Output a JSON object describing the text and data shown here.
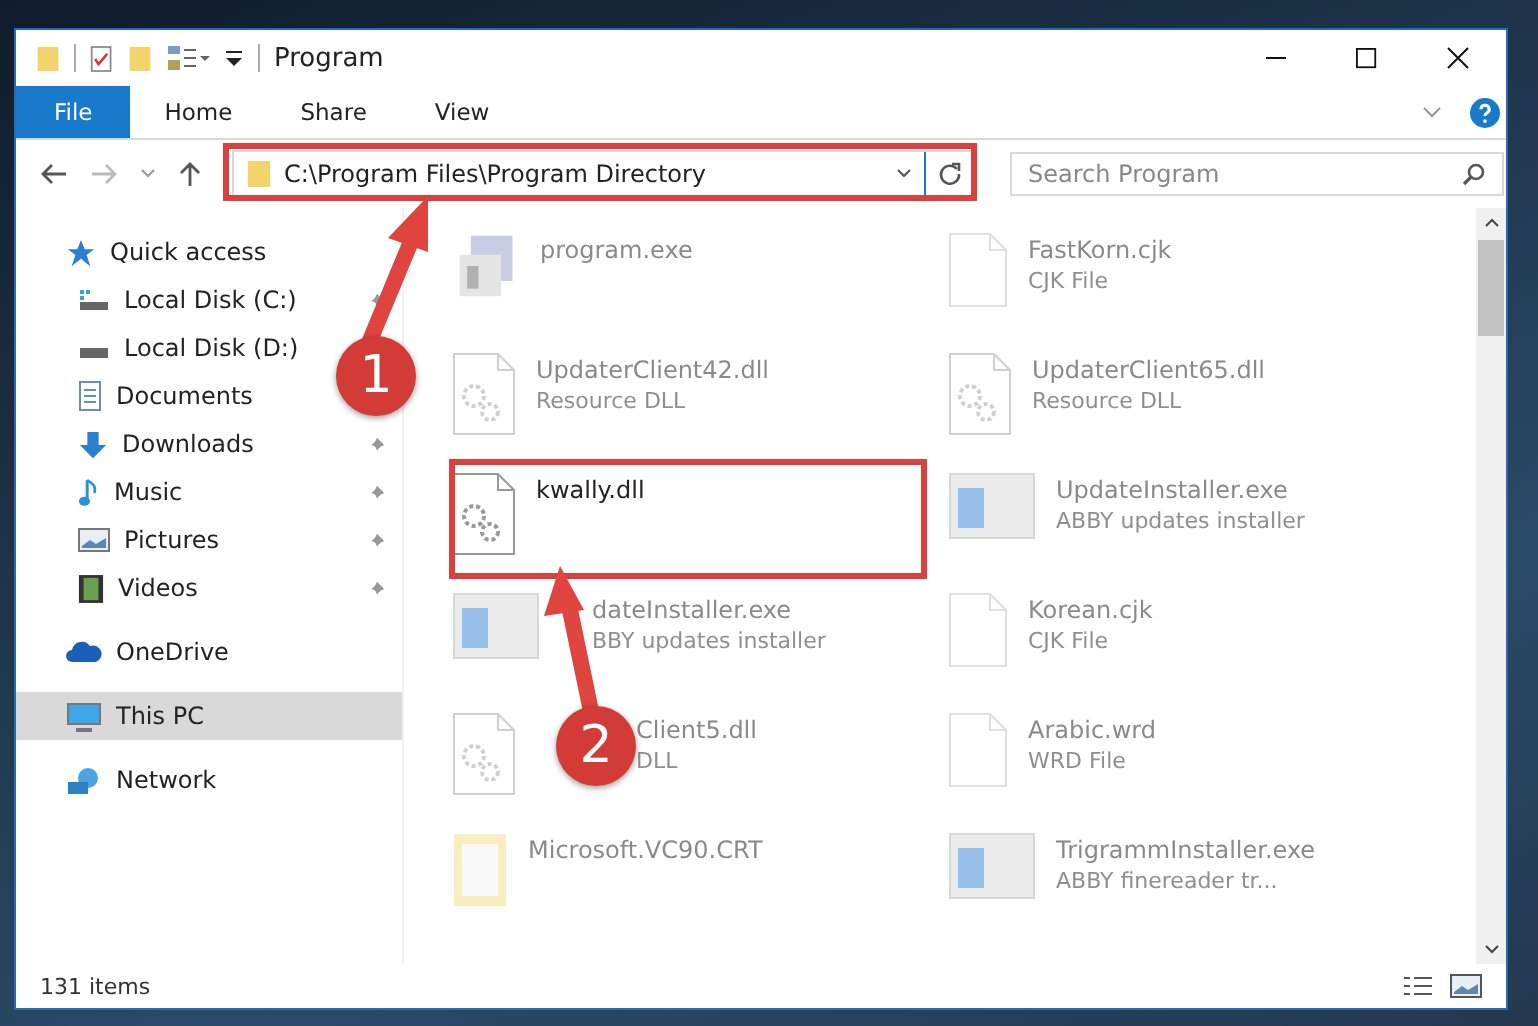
{
  "window": {
    "title": "Program"
  },
  "ribbon_tabs": [
    {
      "label": "File",
      "kind": "file"
    },
    {
      "label": "Home",
      "kind": "tab"
    },
    {
      "label": "Share",
      "kind": "tab"
    },
    {
      "label": "View",
      "kind": "tab"
    }
  ],
  "address": {
    "path": "C:\\Program Files\\Program Directory"
  },
  "search": {
    "placeholder": "Search Program"
  },
  "sidebar": {
    "items": [
      {
        "label": "Quick access",
        "kind": "star",
        "selected": false,
        "children": [
          {
            "label": "Local Disk (C:)",
            "kind": "drive-c",
            "pinned": true
          },
          {
            "label": "Local Disk (D:)",
            "kind": "drive"
          },
          {
            "label": "Documents",
            "kind": "documents"
          },
          {
            "label": "Downloads",
            "kind": "downloads",
            "pinned": true
          },
          {
            "label": "Music",
            "kind": "music",
            "pinned": true
          },
          {
            "label": "Pictures",
            "kind": "pictures",
            "pinned": true
          },
          {
            "label": "Videos",
            "kind": "videos",
            "pinned": true
          }
        ]
      },
      {
        "label": "OneDrive",
        "kind": "cloud",
        "selected": false
      },
      {
        "label": "This PC",
        "kind": "pc",
        "selected": true
      },
      {
        "label": "Network",
        "kind": "network",
        "selected": false
      }
    ]
  },
  "files": [
    {
      "name": "program.exe",
      "kind": "program",
      "faded": true
    },
    {
      "name": "FastKorn.cjk",
      "type": "CJK File",
      "kind": "blank",
      "faded": true
    },
    {
      "name": "UpdaterClient42.dll",
      "type": "Resource DLL",
      "kind": "dll",
      "faded": true
    },
    {
      "name": "UpdaterClient65.dll",
      "type": "Resource DLL",
      "kind": "dll",
      "faded": true
    },
    {
      "name": "kwally.dll",
      "kind": "dll",
      "faded": false
    },
    {
      "name": "UpdateInstaller.exe",
      "type": "ABBY updates installer",
      "kind": "installer",
      "faded": true
    },
    {
      "name": "dateInstaller.exe",
      "type": "BBY updates installer",
      "kind": "installer",
      "faded": true
    },
    {
      "name": "Korean.cjk",
      "type": "CJK File",
      "kind": "blank",
      "faded": true
    },
    {
      "name": "Client5.dll",
      "type": "DLL",
      "kind": "dll",
      "faded": true
    },
    {
      "name": "Arabic.wrd",
      "type": "WRD File",
      "kind": "blank",
      "faded": true
    },
    {
      "name": "Microsoft.VC90.CRT",
      "kind": "folder",
      "faded": true
    },
    {
      "name": "TrigrammInstaller.exe",
      "type": "ABBY finereader tr...",
      "kind": "installer",
      "faded": true
    }
  ],
  "status_bar": {
    "count": "131 items"
  },
  "callouts": [
    {
      "number": "1"
    },
    {
      "number": "2"
    }
  ]
}
